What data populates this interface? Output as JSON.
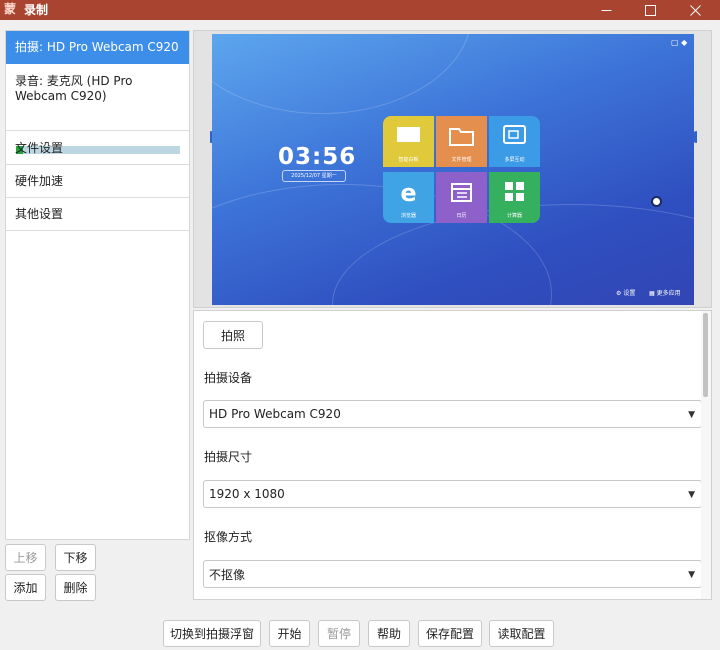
{
  "window": {
    "app_icon_glyph": "蒙",
    "title": "录制",
    "controls": {
      "minimize": "minimize-icon",
      "maximize": "maximize-icon",
      "close": "close-icon"
    }
  },
  "sidebar": {
    "items": [
      {
        "label": "拍摄: HD Pro Webcam C920",
        "active": true
      },
      {
        "label": "录音: 麦克风 (HD Pro Webcam C920)",
        "active": false
      },
      {
        "label": "文件设置",
        "active": false
      },
      {
        "label": "硬件加速",
        "active": false
      },
      {
        "label": "其他设置",
        "active": false
      }
    ],
    "audio_level": 0.04,
    "buttons": {
      "move_up": "上移",
      "move_down": "下移",
      "add": "添加",
      "delete": "删除"
    }
  },
  "preview": {
    "clock": "03:56",
    "date": "2025/12/07 星期一",
    "tiles": [
      {
        "label": "智能白板",
        "color": "#e0c93a",
        "icon": "whiteboard-icon"
      },
      {
        "label": "文件管理",
        "color": "#e58f4e",
        "icon": "folder-icon"
      },
      {
        "label": "多屏互动",
        "color": "#3c9be6",
        "icon": "screen-share-icon"
      },
      {
        "label": "浏览器",
        "color": "#3fa3e4",
        "icon": "browser-icon"
      },
      {
        "label": "日历",
        "color": "#8d61c9",
        "icon": "calendar-icon"
      },
      {
        "label": "计算器",
        "color": "#35b05e",
        "icon": "calculator-icon"
      }
    ],
    "footer_settings": "设置",
    "footer_more": "更多应用"
  },
  "panel": {
    "snapshot_button": "拍照",
    "device_label": "拍摄设备",
    "device_value": "HD Pro Webcam C920",
    "size_label": "拍摄尺寸",
    "size_value": "1920 x 1080",
    "keying_label": "抠像方式",
    "keying_value": "不抠像"
  },
  "bottom_bar": {
    "float_window": "切换到拍摄浮窗",
    "start": "开始",
    "pause": "暂停",
    "help": "帮助",
    "save_config": "保存配置",
    "load_config": "读取配置"
  }
}
